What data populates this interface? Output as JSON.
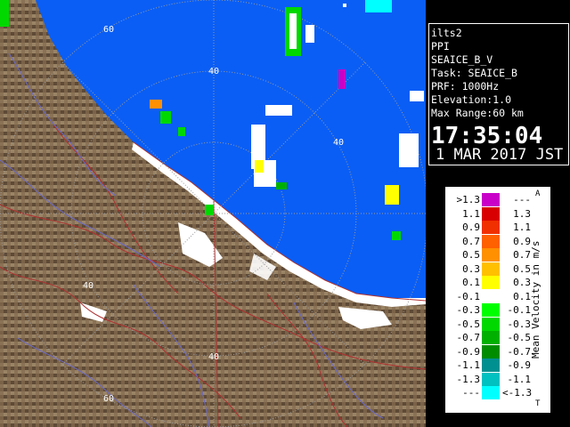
{
  "station": {
    "name": "ilts2",
    "mode": "PPI",
    "product": "SEAICE_B_V",
    "task": "Task: SEAICE_B",
    "prf": "PRF: 1000Hz",
    "elevation": "Elevation:1.0",
    "max_range": "Max Range:60 km",
    "time": "17:35:04",
    "date": "1 MAR 2017 JST"
  },
  "range_ring_labels": [
    "60",
    "40",
    "40",
    "40",
    "40",
    "60"
  ],
  "colors": {
    "sea": "#0a5ef5",
    "land": "#7a6248",
    "coast_ice": "#ffffff",
    "roads": "#b03030",
    "rivers": "#6a6ac8"
  },
  "legend": {
    "title": "Mean Velocity in m/s",
    "tag_top": "A",
    "tag_bottom": "T",
    "rows": [
      {
        "left": ">1.3",
        "right": "---",
        "color": "#c800c8"
      },
      {
        "left": "1.1",
        "right": "1.3",
        "color": "#d80000"
      },
      {
        "left": "0.9",
        "right": "1.1",
        "color": "#f03000"
      },
      {
        "left": "0.7",
        "right": "0.9",
        "color": "#ff6000"
      },
      {
        "left": "0.5",
        "right": "0.7",
        "color": "#ff9000"
      },
      {
        "left": "0.3",
        "right": "0.5",
        "color": "#ffc000"
      },
      {
        "left": "0.1",
        "right": "0.3",
        "color": "#ffff00"
      },
      {
        "left": "-0.1",
        "right": "0.1",
        "color": "#ffffff"
      },
      {
        "left": "-0.3",
        "right": "-0.1",
        "color": "#00ff00"
      },
      {
        "left": "-0.5",
        "right": "-0.3",
        "color": "#00d800"
      },
      {
        "left": "-0.7",
        "right": "-0.5",
        "color": "#00b000"
      },
      {
        "left": "-0.9",
        "right": "-0.7",
        "color": "#008c00"
      },
      {
        "left": "-1.1",
        "right": "-0.9",
        "color": "#009090"
      },
      {
        "left": "-1.3",
        "right": "-1.1",
        "color": "#00c0c0"
      },
      {
        "left": "---",
        "right": "<-1.3",
        "color": "#00ffff"
      }
    ]
  }
}
